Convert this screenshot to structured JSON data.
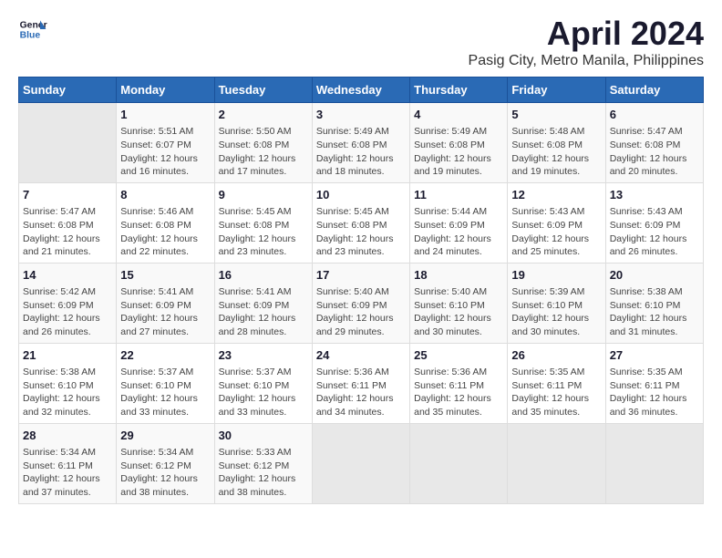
{
  "logo": {
    "line1": "General",
    "line2": "Blue"
  },
  "title": "April 2024",
  "subtitle": "Pasig City, Metro Manila, Philippines",
  "days_header": [
    "Sunday",
    "Monday",
    "Tuesday",
    "Wednesday",
    "Thursday",
    "Friday",
    "Saturday"
  ],
  "weeks": [
    [
      {
        "day": "",
        "info": ""
      },
      {
        "day": "1",
        "info": "Sunrise: 5:51 AM\nSunset: 6:07 PM\nDaylight: 12 hours\nand 16 minutes."
      },
      {
        "day": "2",
        "info": "Sunrise: 5:50 AM\nSunset: 6:08 PM\nDaylight: 12 hours\nand 17 minutes."
      },
      {
        "day": "3",
        "info": "Sunrise: 5:49 AM\nSunset: 6:08 PM\nDaylight: 12 hours\nand 18 minutes."
      },
      {
        "day": "4",
        "info": "Sunrise: 5:49 AM\nSunset: 6:08 PM\nDaylight: 12 hours\nand 19 minutes."
      },
      {
        "day": "5",
        "info": "Sunrise: 5:48 AM\nSunset: 6:08 PM\nDaylight: 12 hours\nand 19 minutes."
      },
      {
        "day": "6",
        "info": "Sunrise: 5:47 AM\nSunset: 6:08 PM\nDaylight: 12 hours\nand 20 minutes."
      }
    ],
    [
      {
        "day": "7",
        "info": "Sunrise: 5:47 AM\nSunset: 6:08 PM\nDaylight: 12 hours\nand 21 minutes."
      },
      {
        "day": "8",
        "info": "Sunrise: 5:46 AM\nSunset: 6:08 PM\nDaylight: 12 hours\nand 22 minutes."
      },
      {
        "day": "9",
        "info": "Sunrise: 5:45 AM\nSunset: 6:08 PM\nDaylight: 12 hours\nand 23 minutes."
      },
      {
        "day": "10",
        "info": "Sunrise: 5:45 AM\nSunset: 6:08 PM\nDaylight: 12 hours\nand 23 minutes."
      },
      {
        "day": "11",
        "info": "Sunrise: 5:44 AM\nSunset: 6:09 PM\nDaylight: 12 hours\nand 24 minutes."
      },
      {
        "day": "12",
        "info": "Sunrise: 5:43 AM\nSunset: 6:09 PM\nDaylight: 12 hours\nand 25 minutes."
      },
      {
        "day": "13",
        "info": "Sunrise: 5:43 AM\nSunset: 6:09 PM\nDaylight: 12 hours\nand 26 minutes."
      }
    ],
    [
      {
        "day": "14",
        "info": "Sunrise: 5:42 AM\nSunset: 6:09 PM\nDaylight: 12 hours\nand 26 minutes."
      },
      {
        "day": "15",
        "info": "Sunrise: 5:41 AM\nSunset: 6:09 PM\nDaylight: 12 hours\nand 27 minutes."
      },
      {
        "day": "16",
        "info": "Sunrise: 5:41 AM\nSunset: 6:09 PM\nDaylight: 12 hours\nand 28 minutes."
      },
      {
        "day": "17",
        "info": "Sunrise: 5:40 AM\nSunset: 6:09 PM\nDaylight: 12 hours\nand 29 minutes."
      },
      {
        "day": "18",
        "info": "Sunrise: 5:40 AM\nSunset: 6:10 PM\nDaylight: 12 hours\nand 30 minutes."
      },
      {
        "day": "19",
        "info": "Sunrise: 5:39 AM\nSunset: 6:10 PM\nDaylight: 12 hours\nand 30 minutes."
      },
      {
        "day": "20",
        "info": "Sunrise: 5:38 AM\nSunset: 6:10 PM\nDaylight: 12 hours\nand 31 minutes."
      }
    ],
    [
      {
        "day": "21",
        "info": "Sunrise: 5:38 AM\nSunset: 6:10 PM\nDaylight: 12 hours\nand 32 minutes."
      },
      {
        "day": "22",
        "info": "Sunrise: 5:37 AM\nSunset: 6:10 PM\nDaylight: 12 hours\nand 33 minutes."
      },
      {
        "day": "23",
        "info": "Sunrise: 5:37 AM\nSunset: 6:10 PM\nDaylight: 12 hours\nand 33 minutes."
      },
      {
        "day": "24",
        "info": "Sunrise: 5:36 AM\nSunset: 6:11 PM\nDaylight: 12 hours\nand 34 minutes."
      },
      {
        "day": "25",
        "info": "Sunrise: 5:36 AM\nSunset: 6:11 PM\nDaylight: 12 hours\nand 35 minutes."
      },
      {
        "day": "26",
        "info": "Sunrise: 5:35 AM\nSunset: 6:11 PM\nDaylight: 12 hours\nand 35 minutes."
      },
      {
        "day": "27",
        "info": "Sunrise: 5:35 AM\nSunset: 6:11 PM\nDaylight: 12 hours\nand 36 minutes."
      }
    ],
    [
      {
        "day": "28",
        "info": "Sunrise: 5:34 AM\nSunset: 6:11 PM\nDaylight: 12 hours\nand 37 minutes."
      },
      {
        "day": "29",
        "info": "Sunrise: 5:34 AM\nSunset: 6:12 PM\nDaylight: 12 hours\nand 38 minutes."
      },
      {
        "day": "30",
        "info": "Sunrise: 5:33 AM\nSunset: 6:12 PM\nDaylight: 12 hours\nand 38 minutes."
      },
      {
        "day": "",
        "info": ""
      },
      {
        "day": "",
        "info": ""
      },
      {
        "day": "",
        "info": ""
      },
      {
        "day": "",
        "info": ""
      }
    ]
  ]
}
